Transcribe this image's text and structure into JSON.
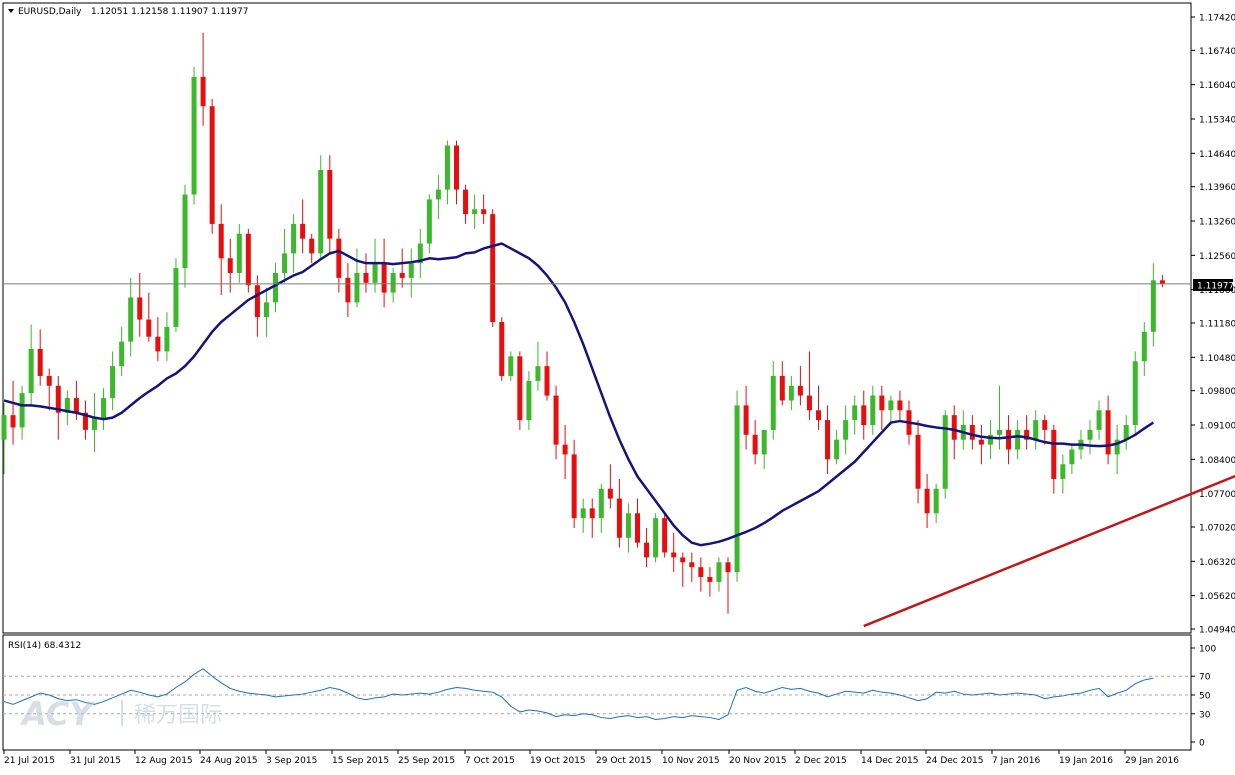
{
  "header": {
    "symbol": "EURUSD,Daily",
    "ohlc": "1.12051 1.12158 1.11907 1.11977"
  },
  "price_axis": {
    "ticks": [
      "1.17420",
      "1.16740",
      "1.16040",
      "1.15340",
      "1.14640",
      "1.13960",
      "1.13260",
      "1.12560",
      "1.11860",
      "1.11180",
      "1.10480",
      "1.09800",
      "1.09100",
      "1.08400",
      "1.07700",
      "1.07020",
      "1.06320",
      "1.05620",
      "1.04940"
    ],
    "current_price_label": "1.11977"
  },
  "date_axis": {
    "labels": [
      "21 Jul 2015",
      "31 Jul 2015",
      "12 Aug 2015",
      "24 Aug 2015",
      "3 Sep 2015",
      "15 Sep 2015",
      "25 Sep 2015",
      "7 Oct 2015",
      "19 Oct 2015",
      "29 Oct 2015",
      "10 Nov 2015",
      "20 Nov 2015",
      "2 Dec 2015",
      "14 Dec 2015",
      "24 Dec 2015",
      "7 Jan 2016",
      "19 Jan 2016",
      "29 Jan 2016"
    ]
  },
  "rsi": {
    "label": "RSI(14) 68.4312",
    "ticks": [
      "100",
      "70",
      "50",
      "30",
      "0"
    ]
  },
  "watermark": {
    "brand": "ACY",
    "text": "稀万国际"
  },
  "colors": {
    "bull": "#3cb82c",
    "bear": "#e60e0e",
    "ma": "#14147e",
    "trendline": "#c81414",
    "rsi": "#1e6fc8",
    "current_line": "#708070"
  },
  "chart_data": [
    {
      "type": "candlestick",
      "title": "EURUSD,Daily",
      "ylim": [
        1.0494,
        1.1742
      ],
      "x_start": "2015-07-20",
      "x_end": "2016-02-05",
      "current_price": 1.11977,
      "ohlc": [
        [
          1.088,
          1.0955,
          1.081,
          1.093
        ],
        [
          1.093,
          1.1,
          1.087,
          1.0905
        ],
        [
          1.0905,
          1.099,
          1.088,
          1.0975
        ],
        [
          1.0975,
          1.1115,
          1.095,
          1.1065
        ],
        [
          1.1065,
          1.1105,
          1.099,
          1.101
        ],
        [
          1.101,
          1.1025,
          1.094,
          1.099
        ],
        [
          1.099,
          1.101,
          1.088,
          1.0935
        ],
        [
          1.0935,
          1.098,
          1.091,
          1.0965
        ],
        [
          1.0965,
          1.1,
          1.092,
          1.0935
        ],
        [
          1.0935,
          1.096,
          1.088,
          1.09
        ],
        [
          1.09,
          1.0975,
          1.0855,
          1.0925
        ],
        [
          1.0925,
          1.0985,
          1.09,
          1.0965
        ],
        [
          1.0965,
          1.106,
          1.094,
          1.103
        ],
        [
          1.103,
          1.111,
          1.101,
          1.108
        ],
        [
          1.108,
          1.121,
          1.105,
          1.117
        ],
        [
          1.117,
          1.122,
          1.109,
          1.1125
        ],
        [
          1.1125,
          1.118,
          1.108,
          1.109
        ],
        [
          1.109,
          1.113,
          1.104,
          1.106
        ],
        [
          1.106,
          1.114,
          1.104,
          1.111
        ],
        [
          1.111,
          1.125,
          1.11,
          1.123
        ],
        [
          1.123,
          1.14,
          1.119,
          1.138
        ],
        [
          1.138,
          1.164,
          1.136,
          1.162
        ],
        [
          1.162,
          1.171,
          1.152,
          1.156
        ],
        [
          1.156,
          1.1575,
          1.13,
          1.132
        ],
        [
          1.132,
          1.136,
          1.1175,
          1.125
        ],
        [
          1.125,
          1.129,
          1.118,
          1.122
        ],
        [
          1.122,
          1.132,
          1.12,
          1.13
        ],
        [
          1.13,
          1.131,
          1.118,
          1.1195
        ],
        [
          1.1195,
          1.1215,
          1.109,
          1.113
        ],
        [
          1.113,
          1.119,
          1.109,
          1.116
        ],
        [
          1.116,
          1.124,
          1.114,
          1.122
        ],
        [
          1.122,
          1.131,
          1.12,
          1.126
        ],
        [
          1.126,
          1.134,
          1.122,
          1.132
        ],
        [
          1.132,
          1.137,
          1.126,
          1.129
        ],
        [
          1.129,
          1.13,
          1.124,
          1.126
        ],
        [
          1.126,
          1.146,
          1.125,
          1.143
        ],
        [
          1.143,
          1.146,
          1.126,
          1.129
        ],
        [
          1.129,
          1.131,
          1.118,
          1.121
        ],
        [
          1.121,
          1.124,
          1.113,
          1.116
        ],
        [
          1.116,
          1.127,
          1.115,
          1.122
        ],
        [
          1.122,
          1.126,
          1.118,
          1.12
        ],
        [
          1.12,
          1.129,
          1.118,
          1.124
        ],
        [
          1.124,
          1.129,
          1.115,
          1.118
        ],
        [
          1.118,
          1.123,
          1.116,
          1.122
        ],
        [
          1.122,
          1.127,
          1.119,
          1.121
        ],
        [
          1.121,
          1.127,
          1.117,
          1.124
        ],
        [
          1.124,
          1.131,
          1.121,
          1.128
        ],
        [
          1.128,
          1.138,
          1.126,
          1.137
        ],
        [
          1.137,
          1.142,
          1.133,
          1.139
        ],
        [
          1.139,
          1.149,
          1.136,
          1.148
        ],
        [
          1.148,
          1.149,
          1.136,
          1.139
        ],
        [
          1.139,
          1.14,
          1.132,
          1.134
        ],
        [
          1.134,
          1.138,
          1.131,
          1.135
        ],
        [
          1.135,
          1.138,
          1.132,
          1.134
        ],
        [
          1.134,
          1.135,
          1.111,
          1.112
        ],
        [
          1.112,
          1.113,
          1.1,
          1.101
        ],
        [
          1.101,
          1.106,
          1.1,
          1.105
        ],
        [
          1.105,
          1.106,
          1.09,
          1.092
        ],
        [
          1.092,
          1.102,
          1.09,
          1.1
        ],
        [
          1.1,
          1.108,
          1.098,
          1.103
        ],
        [
          1.103,
          1.106,
          1.096,
          1.097
        ],
        [
          1.097,
          1.099,
          1.084,
          1.087
        ],
        [
          1.087,
          1.091,
          1.08,
          1.085
        ],
        [
          1.085,
          1.088,
          1.07,
          1.072
        ],
        [
          1.072,
          1.076,
          1.069,
          1.074
        ],
        [
          1.074,
          1.076,
          1.068,
          1.072
        ],
        [
          1.072,
          1.079,
          1.069,
          1.078
        ],
        [
          1.078,
          1.083,
          1.074,
          1.076
        ],
        [
          1.076,
          1.08,
          1.066,
          1.068
        ],
        [
          1.068,
          1.075,
          1.065,
          1.073
        ],
        [
          1.073,
          1.076,
          1.066,
          1.067
        ],
        [
          1.067,
          1.07,
          1.062,
          1.064
        ],
        [
          1.064,
          1.073,
          1.063,
          1.072
        ],
        [
          1.072,
          1.073,
          1.064,
          1.065
        ],
        [
          1.065,
          1.069,
          1.061,
          1.064
        ],
        [
          1.064,
          1.065,
          1.058,
          1.063
        ],
        [
          1.063,
          1.065,
          1.059,
          1.062
        ],
        [
          1.062,
          1.064,
          1.057,
          1.06
        ],
        [
          1.06,
          1.062,
          1.056,
          1.059
        ],
        [
          1.059,
          1.064,
          1.057,
          1.063
        ],
        [
          1.063,
          1.064,
          1.0525,
          1.061
        ],
        [
          1.061,
          1.098,
          1.059,
          1.095
        ],
        [
          1.095,
          1.099,
          1.086,
          1.089
        ],
        [
          1.089,
          1.092,
          1.083,
          1.085
        ],
        [
          1.085,
          1.09,
          1.082,
          1.09
        ],
        [
          1.09,
          1.104,
          1.088,
          1.101
        ],
        [
          1.101,
          1.104,
          1.095,
          1.096
        ],
        [
          1.096,
          1.101,
          1.094,
          1.099
        ],
        [
          1.099,
          1.103,
          1.095,
          1.097
        ],
        [
          1.097,
          1.106,
          1.092,
          1.094
        ],
        [
          1.094,
          1.099,
          1.09,
          1.092
        ],
        [
          1.092,
          1.095,
          1.081,
          1.084
        ],
        [
          1.084,
          1.09,
          1.083,
          1.088
        ],
        [
          1.088,
          1.095,
          1.085,
          1.092
        ],
        [
          1.092,
          1.097,
          1.089,
          1.095
        ],
        [
          1.095,
          1.098,
          1.088,
          1.091
        ],
        [
          1.091,
          1.099,
          1.089,
          1.097
        ],
        [
          1.097,
          1.099,
          1.09,
          1.094
        ],
        [
          1.094,
          1.097,
          1.091,
          1.096
        ],
        [
          1.096,
          1.098,
          1.092,
          1.094
        ],
        [
          1.094,
          1.096,
          1.087,
          1.089
        ],
        [
          1.089,
          1.092,
          1.075,
          1.078
        ],
        [
          1.078,
          1.081,
          1.07,
          1.073
        ],
        [
          1.073,
          1.079,
          1.071,
          1.078
        ],
        [
          1.078,
          1.094,
          1.076,
          1.093
        ],
        [
          1.093,
          1.095,
          1.084,
          1.088
        ],
        [
          1.088,
          1.094,
          1.086,
          1.091
        ],
        [
          1.091,
          1.093,
          1.086,
          1.088
        ],
        [
          1.088,
          1.091,
          1.083,
          1.087
        ],
        [
          1.087,
          1.092,
          1.084,
          1.089
        ],
        [
          1.089,
          1.099,
          1.086,
          1.09
        ],
        [
          1.09,
          1.093,
          1.083,
          1.086
        ],
        [
          1.086,
          1.092,
          1.084,
          1.09
        ],
        [
          1.09,
          1.093,
          1.086,
          1.088
        ],
        [
          1.088,
          1.094,
          1.086,
          1.092
        ],
        [
          1.092,
          1.093,
          1.087,
          1.09
        ],
        [
          1.09,
          1.091,
          1.077,
          1.08
        ],
        [
          1.08,
          1.085,
          1.077,
          1.083
        ],
        [
          1.083,
          1.087,
          1.081,
          1.086
        ],
        [
          1.086,
          1.09,
          1.084,
          1.088
        ],
        [
          1.088,
          1.092,
          1.085,
          1.09
        ],
        [
          1.09,
          1.096,
          1.088,
          1.094
        ],
        [
          1.094,
          1.097,
          1.083,
          1.085
        ],
        [
          1.085,
          1.091,
          1.081,
          1.088
        ],
        [
          1.088,
          1.093,
          1.086,
          1.091
        ],
        [
          1.091,
          1.106,
          1.089,
          1.104
        ],
        [
          1.104,
          1.112,
          1.101,
          1.11
        ],
        [
          1.11,
          1.124,
          1.107,
          1.1205
        ],
        [
          1.1205,
          1.1216,
          1.1191,
          1.11977
        ]
      ],
      "ma": [
        1.096,
        1.0955,
        1.095,
        1.095,
        1.0948,
        1.0945,
        1.0942,
        1.0938,
        1.0935,
        1.093,
        1.0925,
        1.0922,
        1.0925,
        1.0935,
        1.095,
        1.0965,
        1.0978,
        1.099,
        1.1005,
        1.1015,
        1.103,
        1.105,
        1.1075,
        1.11,
        1.112,
        1.1135,
        1.115,
        1.1165,
        1.1175,
        1.1185,
        1.1195,
        1.1205,
        1.1215,
        1.1222,
        1.1235,
        1.1248,
        1.126,
        1.1265,
        1.1255,
        1.1245,
        1.124,
        1.124,
        1.124,
        1.1238,
        1.124,
        1.1242,
        1.1245,
        1.125,
        1.1248,
        1.125,
        1.1252,
        1.126,
        1.1262,
        1.127,
        1.1275,
        1.128,
        1.127,
        1.126,
        1.125,
        1.1235,
        1.1215,
        1.119,
        1.116,
        1.112,
        1.1075,
        1.1025,
        1.0975,
        1.0925,
        1.088,
        1.084,
        1.0805,
        1.078,
        1.0755,
        1.073,
        1.0705,
        1.0685,
        1.067,
        1.0665,
        1.0668,
        1.0672,
        1.0678,
        1.0685,
        1.0692,
        1.07,
        1.071,
        1.0722,
        1.0735,
        1.0745,
        1.0755,
        1.0765,
        1.0775,
        1.079,
        1.0805,
        1.082,
        1.0835,
        1.0855,
        1.0875,
        1.0895,
        1.0915,
        1.0918,
        1.0915,
        1.0912,
        1.0908,
        1.0905,
        1.0903,
        1.09,
        1.0895,
        1.089,
        1.0886,
        1.0884,
        1.0883,
        1.0885,
        1.0887,
        1.0885,
        1.088,
        1.0875,
        1.0872,
        1.0872,
        1.087,
        1.087,
        1.0868,
        1.0867,
        1.0868,
        1.0872,
        1.088,
        1.089,
        1.0903,
        1.0915
      ],
      "trendline": {
        "from": [
          "2015-11-30",
          1.05
        ],
        "to": [
          "2016-02-05",
          1.0865
        ]
      }
    },
    {
      "type": "line",
      "title": "RSI(14) 68.4312",
      "ylim": [
        0,
        100
      ],
      "gridlines": [
        70,
        50,
        30
      ],
      "series": [
        {
          "values": [
            43,
            40,
            44,
            48,
            52,
            50,
            46,
            44,
            45,
            42,
            40,
            43,
            47,
            51,
            55,
            53,
            50,
            48,
            51,
            58,
            64,
            72,
            78,
            70,
            63,
            57,
            54,
            52,
            51,
            50,
            48,
            49,
            50,
            51,
            53,
            55,
            58,
            56,
            52,
            47,
            45,
            47,
            48,
            51,
            50,
            51,
            52,
            51,
            53,
            56,
            58,
            57,
            55,
            54,
            53,
            48,
            38,
            32,
            34,
            33,
            31,
            27,
            29,
            28,
            30,
            29,
            26,
            25,
            27,
            28,
            26,
            27,
            24,
            25,
            27,
            26,
            28,
            27,
            26,
            24,
            29,
            55,
            58,
            54,
            52,
            55,
            58,
            56,
            57,
            54,
            52,
            48,
            51,
            54,
            53,
            52,
            55,
            53,
            52,
            50,
            47,
            44,
            46,
            53,
            52,
            54,
            51,
            50,
            51,
            52,
            50,
            51,
            52,
            51,
            50,
            46,
            48,
            49,
            51,
            52,
            55,
            57,
            48,
            52,
            55,
            62,
            66,
            68
          ]
        }
      ]
    }
  ]
}
